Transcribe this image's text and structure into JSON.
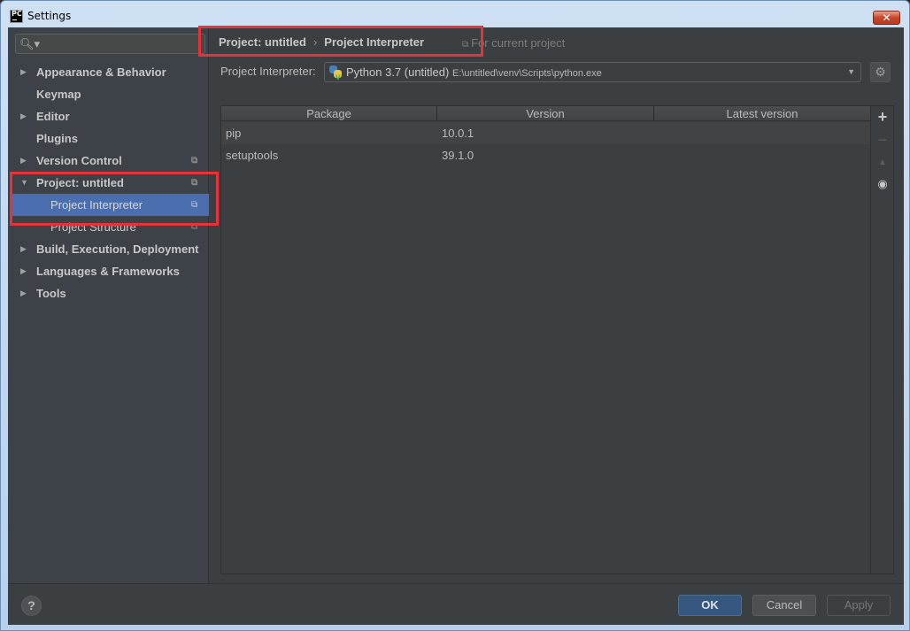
{
  "window": {
    "title": "Settings",
    "app_icon_text": "PC",
    "close_symbol": "✕"
  },
  "sidebar": {
    "search_placeholder": "",
    "items": [
      {
        "label": "Appearance & Behavior",
        "expandable": true,
        "expanded": false,
        "level": 0,
        "project_scoped": false
      },
      {
        "label": "Keymap",
        "expandable": false,
        "level": 0,
        "project_scoped": false
      },
      {
        "label": "Editor",
        "expandable": true,
        "expanded": false,
        "level": 0,
        "project_scoped": false
      },
      {
        "label": "Plugins",
        "expandable": false,
        "level": 0,
        "project_scoped": false
      },
      {
        "label": "Version Control",
        "expandable": true,
        "expanded": false,
        "level": 0,
        "project_scoped": true
      },
      {
        "label": "Project: untitled",
        "expandable": true,
        "expanded": true,
        "level": 0,
        "project_scoped": true
      },
      {
        "label": "Project Interpreter",
        "expandable": false,
        "level": 1,
        "project_scoped": true,
        "selected": true
      },
      {
        "label": "Project Structure",
        "expandable": false,
        "level": 1,
        "project_scoped": true
      },
      {
        "label": "Build, Execution, Deployment",
        "expandable": true,
        "expanded": false,
        "level": 0,
        "project_scoped": false
      },
      {
        "label": "Languages & Frameworks",
        "expandable": true,
        "expanded": false,
        "level": 0,
        "project_scoped": false
      },
      {
        "label": "Tools",
        "expandable": true,
        "expanded": false,
        "level": 0,
        "project_scoped": false
      }
    ]
  },
  "breadcrumb": {
    "parts": [
      "Project: untitled",
      "Project Interpreter"
    ],
    "separator": "›",
    "scope_note": "For current project"
  },
  "interpreter": {
    "label": "Project Interpreter:",
    "selected_name": "Python 3.7 (untitled)",
    "selected_path": "E:\\untitled\\venv\\Scripts\\python.exe"
  },
  "packages": {
    "columns": [
      "Package",
      "Version",
      "Latest version"
    ],
    "rows": [
      {
        "package": "pip",
        "version": "10.0.1",
        "latest": ""
      },
      {
        "package": "setuptools",
        "version": "39.1.0",
        "latest": ""
      }
    ],
    "tools": {
      "add": "+",
      "remove": "−",
      "upgrade": "▲",
      "show_early": "👁"
    }
  },
  "footer": {
    "help": "?",
    "ok": "OK",
    "cancel": "Cancel",
    "apply": "Apply"
  },
  "annotation_color": "#e8323a"
}
